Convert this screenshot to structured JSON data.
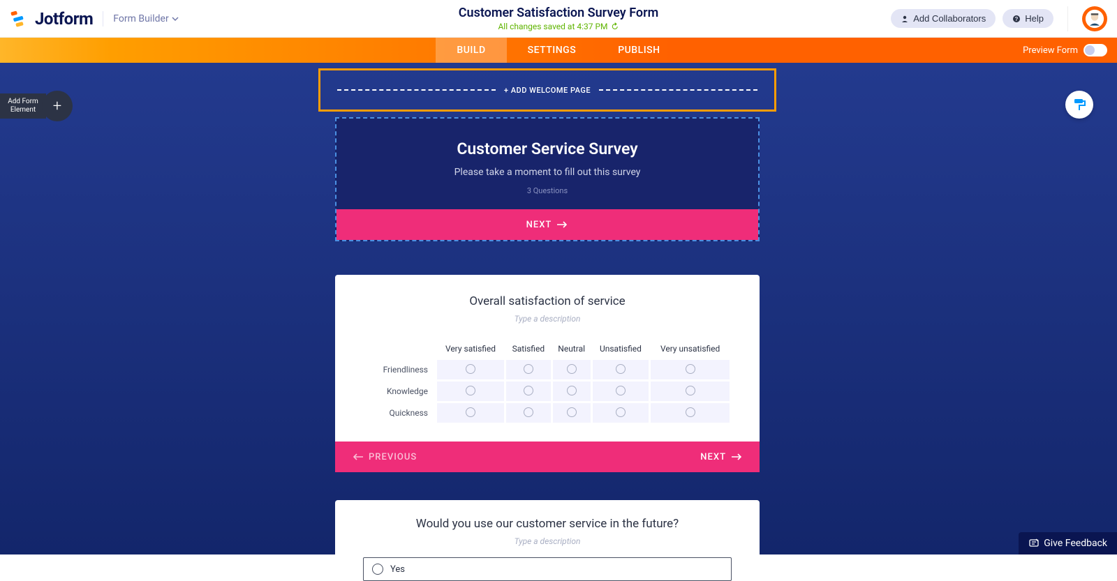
{
  "header": {
    "logo_text": "Jotform",
    "form_builder_label": "Form Builder",
    "title": "Customer Satisfaction Survey Form",
    "save_status": "All changes saved at 4:37 PM",
    "collaborators_label": "Add Collaborators",
    "help_label": "Help"
  },
  "tabs": {
    "build": "BUILD",
    "settings": "SETTINGS",
    "publish": "PUBLISH",
    "preview_label": "Preview Form"
  },
  "sidebar": {
    "add_element_line1": "Add Form",
    "add_element_line2": "Element"
  },
  "welcome_slot": {
    "label": "+ ADD WELCOME PAGE"
  },
  "card1": {
    "title": "Customer Service Survey",
    "subtitle": "Please take a moment to fill out this survey",
    "questions_count": "3  Questions",
    "next_label": "NEXT"
  },
  "card2": {
    "title": "Overall satisfaction of service",
    "desc_placeholder": "Type a description",
    "columns": [
      "Very satisfied",
      "Satisfied",
      "Neutral",
      "Unsatisfied",
      "Very unsatisfied"
    ],
    "rows": [
      "Friendliness",
      "Knowledge",
      "Quickness"
    ],
    "prev_label": "PREVIOUS",
    "next_label": "NEXT"
  },
  "card3": {
    "title": "Would you use our customer service in the future?",
    "desc_placeholder": "Type a description",
    "option_yes": "Yes"
  },
  "footer": {
    "feedback_label": "Give Feedback"
  }
}
